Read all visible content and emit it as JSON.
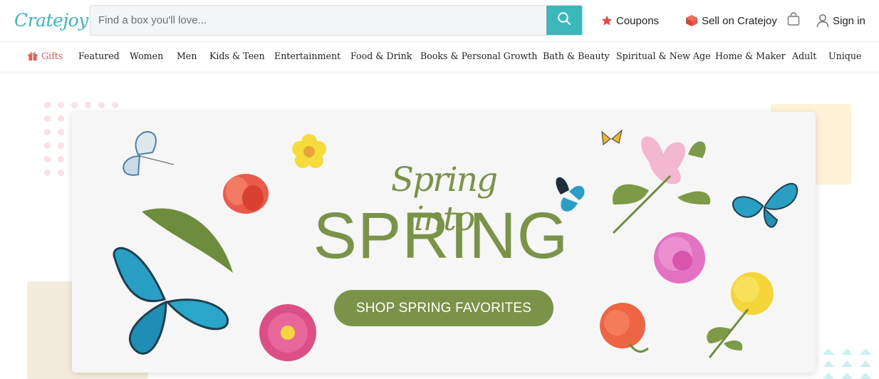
{
  "header": {
    "logo_text": "Cratejoy",
    "search_placeholder": "Find a box you'll love...",
    "coupons_label": "Coupons",
    "sell_label": "Sell on Cratejoy",
    "signin_label": "Sign in"
  },
  "nav": {
    "items": [
      "Gifts",
      "Featured",
      "Women",
      "Men",
      "Kids & Teen",
      "Entertainment",
      "Food & Drink",
      "Books & Personal Growth",
      "Bath & Beauty",
      "Spiritual & New Age",
      "Home & Maker",
      "Adult",
      "Unique"
    ]
  },
  "hero": {
    "script_title": "Spring into",
    "big_title": "SPRING",
    "cta_label": "SHOP SPRING FAVORITES"
  },
  "colors": {
    "brand_teal": "#3bb8b9",
    "accent_green": "#7a9348",
    "gift_red": "#e45e5e"
  },
  "icons": [
    "search-icon",
    "star-icon",
    "box-icon",
    "bag-icon",
    "user-icon",
    "gift-icon"
  ]
}
